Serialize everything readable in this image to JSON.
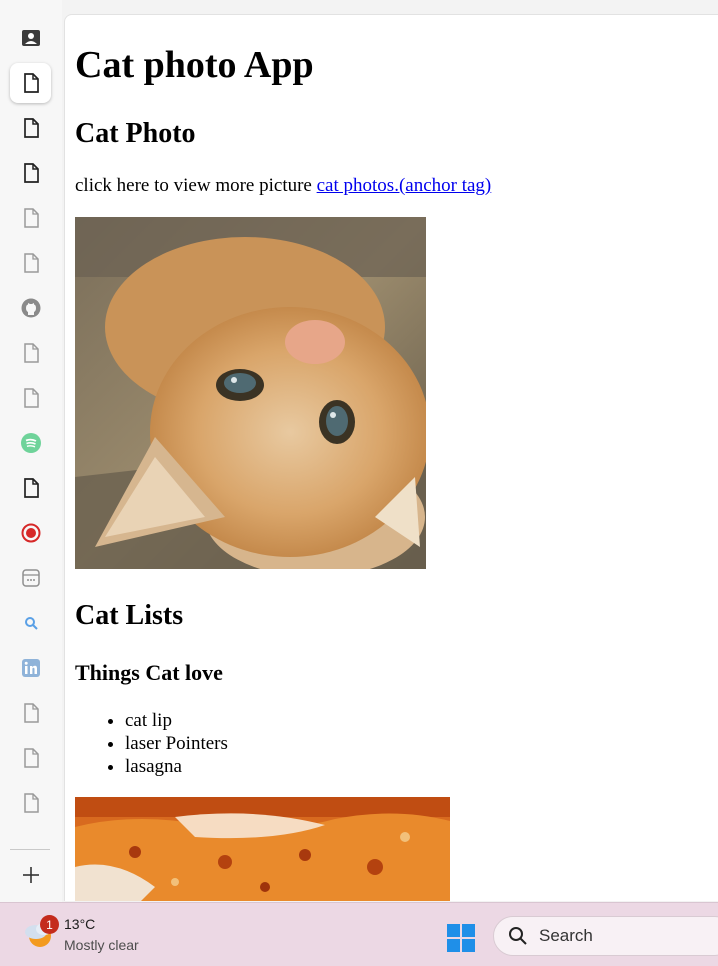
{
  "page": {
    "title": "Cat photo App",
    "section1_heading": "Cat Photo",
    "paragraph_text": "click here to view more picture ",
    "link_text": "cat photos.(anchor tag)",
    "section2_heading": "Cat Lists",
    "subheading": "Things Cat love",
    "list_items": [
      "cat lip",
      "laser Pointers",
      "lasagna"
    ]
  },
  "sidebar": {
    "icons": [
      "contact-card-icon",
      "document-icon",
      "document-icon",
      "document-icon",
      "document-icon",
      "document-icon",
      "github-icon",
      "document-icon",
      "document-icon",
      "spotify-icon",
      "document-icon",
      "record-icon",
      "dashboard-icon",
      "search-icon",
      "linkedin-icon",
      "document-icon",
      "document-icon",
      "document-icon",
      "add-icon"
    ]
  },
  "taskbar": {
    "weather_badge": "1",
    "temperature": "13°C",
    "condition": "Mostly clear",
    "search_label": "Search"
  },
  "colors": {
    "link": "#0000ee",
    "taskbar_bg": "#ecd8e4",
    "badge": "#c42b1c",
    "windows_blue": "#1f8fe8"
  }
}
